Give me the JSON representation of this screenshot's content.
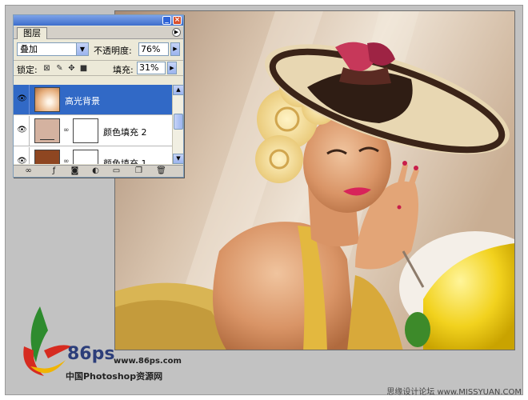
{
  "palette": {
    "tab_label": "图层",
    "blend_mode": "叠加",
    "opacity_label": "不透明度:",
    "opacity_value": "76%",
    "lock_label": "锁定:",
    "fill_label": "填充:",
    "fill_value": "31%",
    "layers": [
      {
        "name": "高光背景",
        "selected": true
      },
      {
        "name": "颜色填充 2",
        "selected": false
      },
      {
        "name": "颜色填充 1",
        "selected": false
      }
    ]
  },
  "watermark": {
    "brand": "86ps",
    "url": "www.86ps.com",
    "site_name": "中国Photoshop资源网",
    "right_text": "思缘设计论坛 www.MISSYUAN.COM"
  },
  "colors": {
    "selection": "#3169c6",
    "titlebar": "#3d6dcc",
    "layer2_fill": "#d4b2a0",
    "layer1_fill": "#8e4621"
  }
}
